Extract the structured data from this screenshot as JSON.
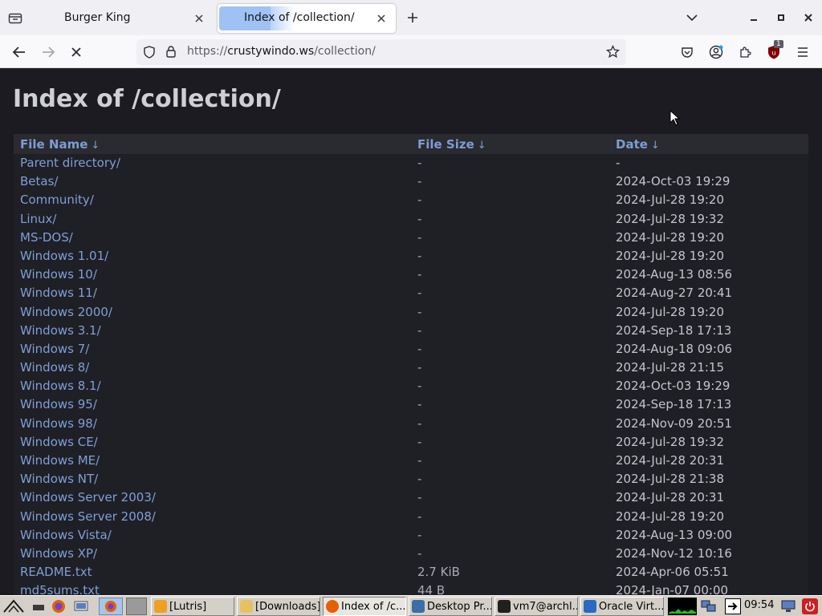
{
  "browser": {
    "tabs": [
      {
        "title": "Burger King",
        "active": false
      },
      {
        "title": "Index of /collection/",
        "active": true
      }
    ],
    "url": {
      "prefix": "https://",
      "host": "crustywindo.ws",
      "path": "/collection/"
    },
    "extension_badge": "1"
  },
  "page": {
    "heading": "Index of /collection/",
    "columns": {
      "name": "File Name",
      "size": "File Size",
      "date": "Date",
      "sort_arrow": "↓"
    },
    "rows": [
      {
        "name": "Parent directory/",
        "size": "-",
        "date": "-"
      },
      {
        "name": "Betas/",
        "size": "-",
        "date": "2024-Oct-03 19:29"
      },
      {
        "name": "Community/",
        "size": "-",
        "date": "2024-Jul-28 19:20"
      },
      {
        "name": "Linux/",
        "size": "-",
        "date": "2024-Jul-28 19:32"
      },
      {
        "name": "MS-DOS/",
        "size": "-",
        "date": "2024-Jul-28 19:20"
      },
      {
        "name": "Windows 1.01/",
        "size": "-",
        "date": "2024-Jul-28 19:20"
      },
      {
        "name": "Windows 10/",
        "size": "-",
        "date": "2024-Aug-13 08:56"
      },
      {
        "name": "Windows 11/",
        "size": "-",
        "date": "2024-Aug-27 20:41"
      },
      {
        "name": "Windows 2000/",
        "size": "-",
        "date": "2024-Jul-28 19:20"
      },
      {
        "name": "Windows 3.1/",
        "size": "-",
        "date": "2024-Sep-18 17:13"
      },
      {
        "name": "Windows 7/",
        "size": "-",
        "date": "2024-Aug-18 09:06"
      },
      {
        "name": "Windows 8/",
        "size": "-",
        "date": "2024-Jul-28 21:15"
      },
      {
        "name": "Windows 8.1/",
        "size": "-",
        "date": "2024-Oct-03 19:29"
      },
      {
        "name": "Windows 95/",
        "size": "-",
        "date": "2024-Sep-18 17:13"
      },
      {
        "name": "Windows 98/",
        "size": "-",
        "date": "2024-Nov-09 20:51"
      },
      {
        "name": "Windows CE/",
        "size": "-",
        "date": "2024-Jul-28 19:32"
      },
      {
        "name": "Windows ME/",
        "size": "-",
        "date": "2024-Jul-28 20:31"
      },
      {
        "name": "Windows NT/",
        "size": "-",
        "date": "2024-Jul-28 21:38"
      },
      {
        "name": "Windows Server 2003/",
        "size": "-",
        "date": "2024-Jul-28 20:31"
      },
      {
        "name": "Windows Server 2008/",
        "size": "-",
        "date": "2024-Jul-28 19:20"
      },
      {
        "name": "Windows Vista/",
        "size": "-",
        "date": "2024-Aug-13 09:00"
      },
      {
        "name": "Windows XP/",
        "size": "-",
        "date": "2024-Nov-12 10:16"
      },
      {
        "name": "README.txt",
        "size": "2.7 KiB",
        "date": "2024-Apr-06 05:51"
      },
      {
        "name": "md5sums.txt",
        "size": "44 B",
        "date": "2024-Jan-07 00:00"
      }
    ]
  },
  "taskbar": {
    "tasks": [
      {
        "label": "[Lutris]",
        "icon": "lutris-icon",
        "color": "#f0a020"
      },
      {
        "label": "[Downloads]",
        "icon": "folder-icon",
        "color": "#e8c060"
      },
      {
        "label": "Index of /c...",
        "icon": "firefox-icon",
        "color": "#e66000",
        "active": true
      },
      {
        "label": "Desktop Pr...",
        "icon": "settings-window-icon",
        "color": "#3a6ea5"
      },
      {
        "label": "vm7@archl...",
        "icon": "terminal-icon",
        "color": "#202020"
      },
      {
        "label": "Oracle Virt...",
        "icon": "virtualbox-icon",
        "color": "#2a6ac0"
      }
    ],
    "clock": "09:54"
  },
  "colors": {
    "page_bg": "#1c1b22",
    "link": "#7f9fd6",
    "heading": "#cfcfd6"
  }
}
